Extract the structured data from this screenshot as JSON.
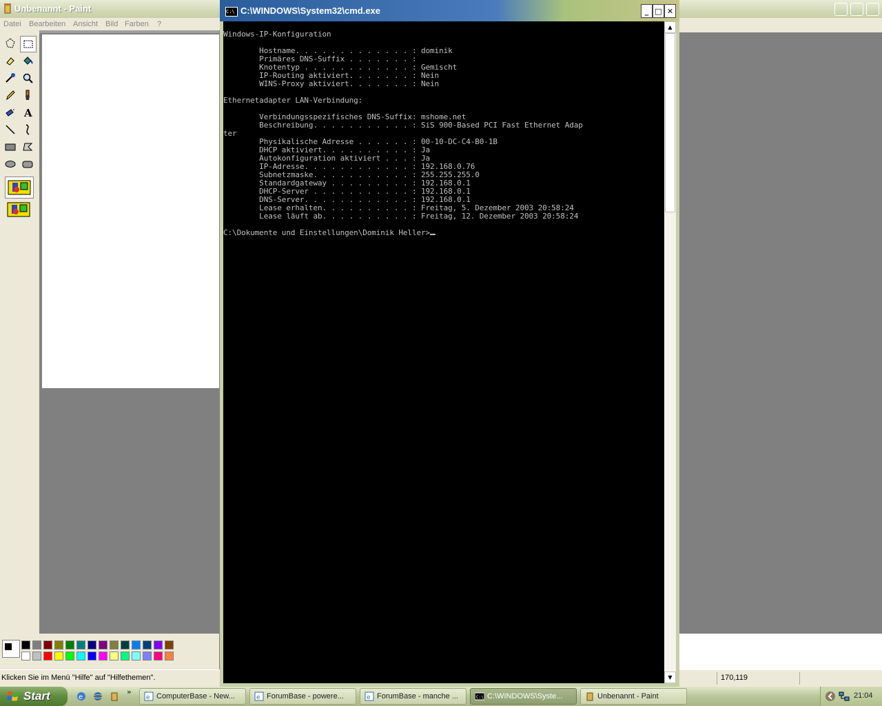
{
  "paint": {
    "title": "Unbenannt - Paint",
    "menu": [
      "Datei",
      "Bearbeiten",
      "Ansicht",
      "Bild",
      "Farben",
      "?"
    ],
    "status_text": "Klicken Sie im Menü \"Hilfe\" auf \"Hilfethemen\".",
    "coords": "170,119",
    "palette_row1": [
      "#000000",
      "#808080",
      "#800000",
      "#808000",
      "#008000",
      "#008080",
      "#000080",
      "#800080",
      "#808040",
      "#004040",
      "#0080ff",
      "#004080",
      "#8000ff",
      "#804000"
    ],
    "palette_row2": [
      "#ffffff",
      "#c0c0c0",
      "#ff0000",
      "#ffff00",
      "#00ff00",
      "#00ffff",
      "#0000ff",
      "#ff00ff",
      "#ffff80",
      "#00ff80",
      "#80ffff",
      "#8080ff",
      "#ff0080",
      "#ff8040"
    ],
    "tools": [
      "free-select-icon",
      "rect-select-icon",
      "eraser-icon",
      "fill-icon",
      "color-picker-icon",
      "magnifier-icon",
      "pencil-icon",
      "brush-icon",
      "airbrush-icon",
      "text-icon",
      "line-icon",
      "curve-icon",
      "rectangle-icon",
      "polygon-icon",
      "ellipse-icon",
      "rounded-rect-icon"
    ]
  },
  "cmd": {
    "title": "C:\\WINDOWS\\System32\\cmd.exe",
    "icon_text": "C:\\",
    "minimize": "_",
    "maximize": "□",
    "close": "✕",
    "console_lines": [
      "Windows-IP-Konfiguration",
      "",
      "        Hostname. . . . . . . . . . . . . : dominik",
      "        Primäres DNS-Suffix . . . . . . . :",
      "        Knotentyp . . . . . . . . . . . . : Gemischt",
      "        IP-Routing aktiviert. . . . . . . : Nein",
      "        WINS-Proxy aktiviert. . . . . . . : Nein",
      "",
      "Ethernetadapter LAN-Verbindung:",
      "",
      "        Verbindungsspezifisches DNS-Suffix: mshome.net",
      "        Beschreibung. . . . . . . . . . . : SiS 900-Based PCI Fast Ethernet Adap",
      "ter",
      "        Physikalische Adresse . . . . . . : 00-10-DC-C4-B0-1B",
      "        DHCP aktiviert. . . . . . . . . . : Ja",
      "        Autokonfiguration aktiviert . . . : Ja",
      "        IP-Adresse. . . . . . . . . . . . : 192.168.0.76",
      "        Subnetzmaske. . . . . . . . . . . : 255.255.255.0",
      "        Standardgateway . . . . . . . . . : 192.168.0.1",
      "        DHCP-Server . . . . . . . . . . . : 192.168.0.1",
      "        DNS-Server. . . . . . . . . . . . : 192.168.0.1",
      "        Lease erhalten. . . . . . . . . . : Freitag, 5. Dezember 2003 20:58:24",
      "        Lease läuft ab. . . . . . . . . . : Freitag, 12. Dezember 2003 20:58:24",
      "",
      "C:\\Dokumente und Einstellungen\\Dominik Heller>"
    ]
  },
  "taskbar": {
    "start_label": "Start",
    "tasks": [
      {
        "label": "ComputerBase - New...",
        "active": false
      },
      {
        "label": "ForumBase - powere...",
        "active": false
      },
      {
        "label": "ForumBase - manche ...",
        "active": false
      },
      {
        "label": "C:\\WINDOWS\\Syste...",
        "active": true
      },
      {
        "label": "Unbenannt - Paint",
        "active": false
      }
    ],
    "clock": "21:04",
    "chevron": "»"
  }
}
